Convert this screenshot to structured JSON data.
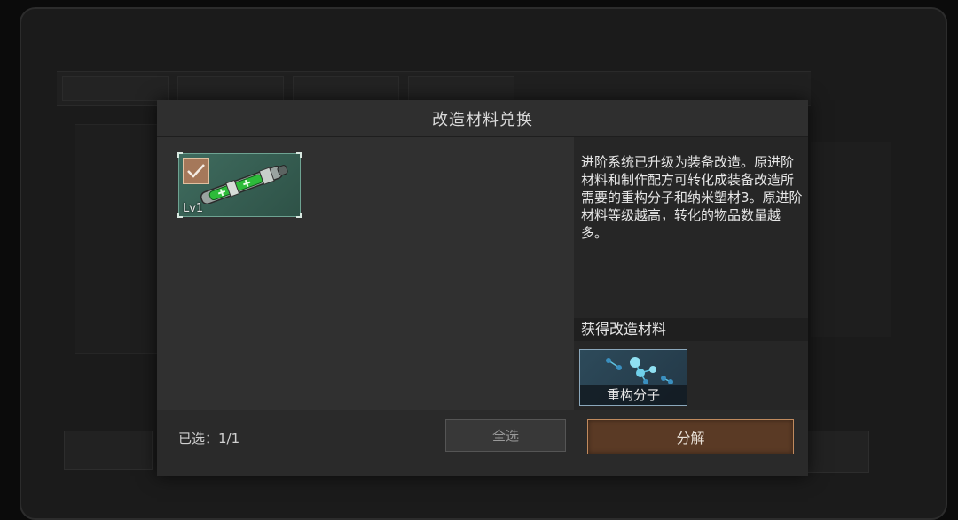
{
  "modal": {
    "title": "改造材料兑换",
    "selected_item": {
      "level": "Lv1",
      "checked": true,
      "icon": "laser-tube-icon"
    },
    "selected_count": "已选：1/1",
    "select_all_label": "全选",
    "description": "进阶系统已升级为装备改造。原进阶材料和制作配方可转化成装备改造所需要的重构分子和纳米塑材3。原进阶材料等级越高，转化的物品数量越多。",
    "reward_header": "获得改造材料",
    "reward_item": {
      "name": "重构分子",
      "icon": "molecule-icon"
    },
    "decompose_label": "分解"
  },
  "colors": {
    "accent_button": "#5a3a25",
    "accent_border": "#c08a5e",
    "item_card": "#3f6b5e",
    "reward_card": "#2d4a5a"
  }
}
